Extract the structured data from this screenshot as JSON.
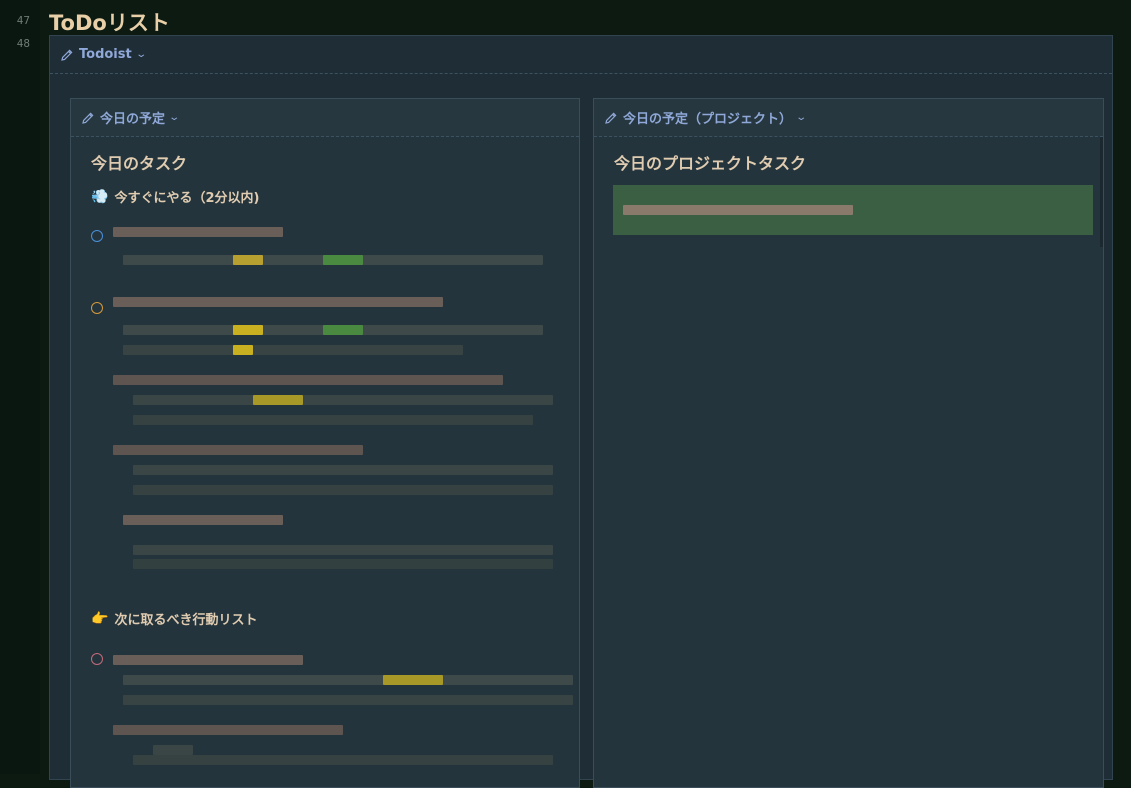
{
  "editor": {
    "line_numbers": [
      "47",
      "48"
    ],
    "doc_title": "ToDoリスト"
  },
  "outer_block": {
    "label": "Todoist"
  },
  "left_panel": {
    "header_label": "今日の予定",
    "title": "今日のタスク",
    "section_1": {
      "icon": "💨",
      "label": "今すぐにやる（2分以内)"
    },
    "section_2": {
      "icon": "👉",
      "label": "次に取るべき行動リスト"
    }
  },
  "right_panel": {
    "header_label": "今日の予定（プロジェクト）",
    "title": "今日のプロジェクトタスク"
  },
  "colors": {
    "priority_blue": "#4a90d9",
    "priority_orange": "#d49a3a",
    "priority_red": "#c46a7a",
    "project_highlight": "#3a5f42"
  }
}
